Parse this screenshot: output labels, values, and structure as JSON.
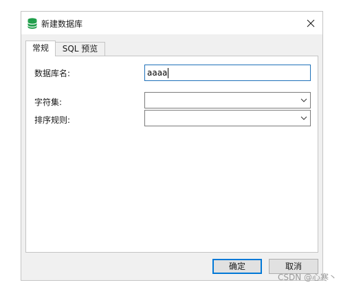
{
  "window": {
    "title": "新建数据库",
    "icon": "database-icon"
  },
  "tabs": [
    {
      "label": "常规",
      "active": true
    },
    {
      "label": "SQL 预览",
      "active": false
    }
  ],
  "form": {
    "db_name_label": "数据库名:",
    "db_name_value": "aaaa",
    "charset_label": "字符集:",
    "charset_value": "",
    "collation_label": "排序规则:",
    "collation_value": ""
  },
  "buttons": {
    "ok_label": "确定",
    "cancel_label": "取消"
  },
  "watermark": "CSDN @心寒丶",
  "colors": {
    "accent": "#0078d7",
    "icon_green": "#1f9e4a"
  }
}
